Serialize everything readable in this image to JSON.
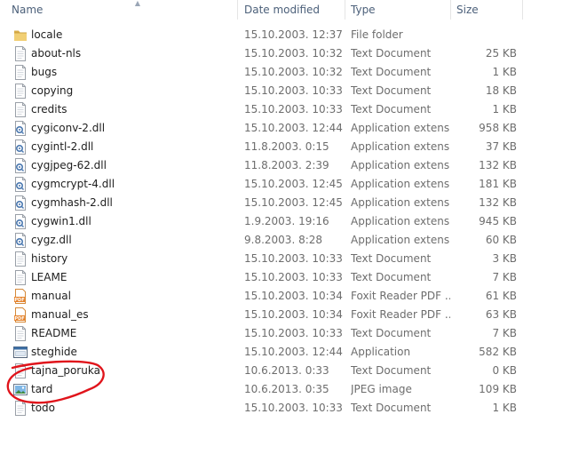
{
  "columns": {
    "name": "Name",
    "date": "Date modified",
    "type": "Type",
    "size": "Size"
  },
  "files": [
    {
      "name": "locale",
      "date": "15.10.2003. 12:37",
      "type": "File folder",
      "size": "",
      "icon": "folder-icon"
    },
    {
      "name": "about-nls",
      "date": "15.10.2003. 10:32",
      "type": "Text Document",
      "size": "25 KB",
      "icon": "text-document-icon"
    },
    {
      "name": "bugs",
      "date": "15.10.2003. 10:32",
      "type": "Text Document",
      "size": "1 KB",
      "icon": "text-document-icon"
    },
    {
      "name": "copying",
      "date": "15.10.2003. 10:33",
      "type": "Text Document",
      "size": "18 KB",
      "icon": "text-document-icon"
    },
    {
      "name": "credits",
      "date": "15.10.2003. 10:33",
      "type": "Text Document",
      "size": "1 KB",
      "icon": "text-document-icon"
    },
    {
      "name": "cygiconv-2.dll",
      "date": "15.10.2003. 12:44",
      "type": "Application extens...",
      "size": "958 KB",
      "icon": "dll-icon"
    },
    {
      "name": "cygintl-2.dll",
      "date": "11.8.2003. 0:15",
      "type": "Application extens...",
      "size": "37 KB",
      "icon": "dll-icon"
    },
    {
      "name": "cygjpeg-62.dll",
      "date": "11.8.2003. 2:39",
      "type": "Application extens...",
      "size": "132 KB",
      "icon": "dll-icon"
    },
    {
      "name": "cygmcrypt-4.dll",
      "date": "15.10.2003. 12:45",
      "type": "Application extens...",
      "size": "181 KB",
      "icon": "dll-icon"
    },
    {
      "name": "cygmhash-2.dll",
      "date": "15.10.2003. 12:45",
      "type": "Application extens...",
      "size": "132 KB",
      "icon": "dll-icon"
    },
    {
      "name": "cygwin1.dll",
      "date": "1.9.2003. 19:16",
      "type": "Application extens...",
      "size": "945 KB",
      "icon": "dll-icon"
    },
    {
      "name": "cygz.dll",
      "date": "9.8.2003. 8:28",
      "type": "Application extens...",
      "size": "60 KB",
      "icon": "dll-icon"
    },
    {
      "name": "history",
      "date": "15.10.2003. 10:33",
      "type": "Text Document",
      "size": "3 KB",
      "icon": "text-document-icon"
    },
    {
      "name": "LEAME",
      "date": "15.10.2003. 10:33",
      "type": "Text Document",
      "size": "7 KB",
      "icon": "text-document-icon"
    },
    {
      "name": "manual",
      "date": "15.10.2003. 10:34",
      "type": "Foxit Reader PDF ...",
      "size": "61 KB",
      "icon": "pdf-icon"
    },
    {
      "name": "manual_es",
      "date": "15.10.2003. 10:34",
      "type": "Foxit Reader PDF ...",
      "size": "63 KB",
      "icon": "pdf-icon"
    },
    {
      "name": "README",
      "date": "15.10.2003. 10:33",
      "type": "Text Document",
      "size": "7 KB",
      "icon": "text-document-icon"
    },
    {
      "name": "steghide",
      "date": "15.10.2003. 12:44",
      "type": "Application",
      "size": "582 KB",
      "icon": "application-icon"
    },
    {
      "name": "tajna_poruka",
      "date": "10.6.2013. 0:33",
      "type": "Text Document",
      "size": "0 KB",
      "icon": "text-document-icon"
    },
    {
      "name": "tard",
      "date": "10.6.2013. 0:35",
      "type": "JPEG image",
      "size": "109 KB",
      "icon": "jpeg-image-icon"
    },
    {
      "name": "todo",
      "date": "15.10.2003. 10:33",
      "type": "Text Document",
      "size": "1 KB",
      "icon": "text-document-icon"
    }
  ],
  "colors": {
    "header_text": "#4c607a",
    "name_text": "#1e1e1e",
    "detail_text": "#6d6d6d",
    "folder": "#e8c46a",
    "annotation": "#e0141b"
  }
}
